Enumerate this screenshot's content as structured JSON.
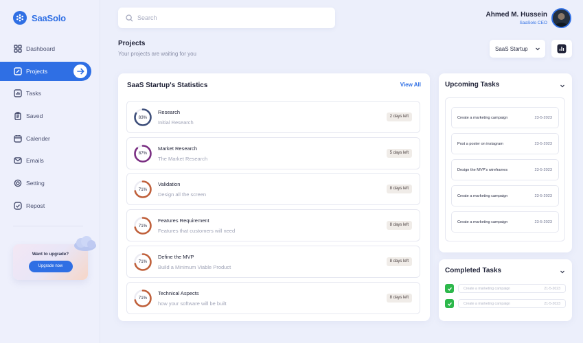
{
  "app": {
    "name": "SaaSolo"
  },
  "sidebar": {
    "items": [
      {
        "label": "Dashboard",
        "icon": "grid-icon"
      },
      {
        "label": "Projects",
        "icon": "edit-icon",
        "active": true
      },
      {
        "label": "Tasks",
        "icon": "chart-icon"
      },
      {
        "label": "Saved",
        "icon": "clipboard-icon"
      },
      {
        "label": "Calender",
        "icon": "calendar-icon"
      },
      {
        "label": "Emails",
        "icon": "mail-icon"
      },
      {
        "label": "Setting",
        "icon": "gear-icon"
      },
      {
        "label": "Repost",
        "icon": "check-square-icon"
      }
    ],
    "upgrade": {
      "title": "Want to upgrade?",
      "button": "Upgrade now"
    }
  },
  "search": {
    "placeholder": "Search"
  },
  "user": {
    "name": "Ahmed M. Hussein",
    "role": "SaaSolo CEO"
  },
  "header": {
    "title": "Projects",
    "subtitle": "Your projects are waiting for you"
  },
  "project_select": {
    "value": "SaaS Startup"
  },
  "stats": {
    "title": "SaaS Startup's Statistics",
    "view_all": "View All",
    "projects": [
      {
        "name": "Research",
        "desc": "Initial Research",
        "percent": "83%",
        "value": 83,
        "days": "2 days left",
        "color": "#3e4f7a"
      },
      {
        "name": "Market Research",
        "desc": "The Market Research",
        "percent": "87%",
        "value": 87,
        "days": "5 days left",
        "color": "#7a2e82"
      },
      {
        "name": "Validation",
        "desc": "Design all the screen",
        "percent": "71%",
        "value": 71,
        "days": "8 days left",
        "color": "#c0603a"
      },
      {
        "name": "Features Requirement",
        "desc": "Features that customers will need",
        "percent": "71%",
        "value": 71,
        "days": "8 days left",
        "color": "#c0603a"
      },
      {
        "name": "Define the MVP",
        "desc": "Build a Minimum Viable Product",
        "percent": "71%",
        "value": 71,
        "days": "8 days left",
        "color": "#c0603a"
      },
      {
        "name": "Technical Aspects",
        "desc": "how your software will be built",
        "percent": "71%",
        "value": 71,
        "days": "8 days left",
        "color": "#c0603a"
      }
    ]
  },
  "upcoming": {
    "title": "Upcoming Tasks",
    "tasks": [
      {
        "name": "Create a marketing campaign",
        "date": "23-5-2023"
      },
      {
        "name": "Post a poster on instagram",
        "date": "23-5-2023"
      },
      {
        "name": "Design the MVP's wireframes",
        "date": "23-5-2023"
      },
      {
        "name": "Create a marketing campaign",
        "date": "23-5-2023"
      },
      {
        "name": "Create a marketing campaign",
        "date": "23-5-2023"
      }
    ]
  },
  "completed": {
    "title": "Completed Tasks",
    "tasks": [
      {
        "name": "Create a marketing campaign",
        "date": "21-5-2023"
      },
      {
        "name": "Create a marketing campaign",
        "date": "21-5-2023"
      }
    ]
  },
  "colors": {
    "accent": "#2f6fe4",
    "success": "#2db84b",
    "background": "#eceffb"
  }
}
